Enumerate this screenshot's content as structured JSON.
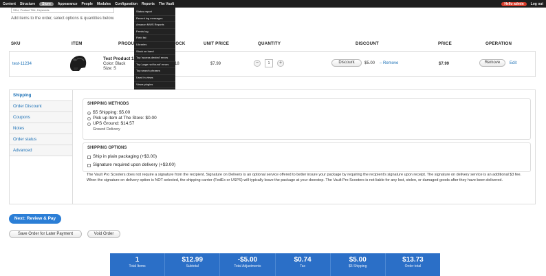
{
  "admin_bar": {
    "menu": [
      "Content",
      "Structure",
      "Store",
      "Appearance",
      "People",
      "Modules",
      "Configuration",
      "Reports",
      "The Vault"
    ],
    "user": "Hello admin",
    "logout": "Log out"
  },
  "reports_menu": [
    "Status report",
    "Recent log messages",
    "Amazon MWS Reports",
    "Feeds log",
    "Field list",
    "Libraries",
    "Stock on hand",
    "Top 'access denied' errors",
    "Top 'page not found' errors",
    "Top search phrases",
    "Used in views",
    "Views plugins"
  ],
  "order": {
    "search_placeholder": "SKU, Product Title, Keywords",
    "add_items_text": "Add items to the order, select options & quantities below.",
    "columns": [
      "SKU",
      "ITEM",
      "PRODUCT",
      "STOCK",
      "UNIT PRICE",
      "QUANTITY",
      "DISCOUNT",
      "PRICE",
      "OPERATION"
    ],
    "line": {
      "sku": "test-11234",
      "product_name": "Test Product 1",
      "color": "Color: Black",
      "size": "Size: S",
      "stock": "18",
      "unit_price": "$7.99",
      "qty_minus": "−",
      "quantity": "1",
      "qty_plus": "+",
      "discount_button": "Discount",
      "discount_amount": "$5.00",
      "discount_remove": "– Remove",
      "price": "$7.99",
      "remove_button": "Remove",
      "edit_link": "Edit"
    }
  },
  "tabs": [
    "Shipping",
    "Order Discount",
    "Coupons",
    "Notes",
    "Order status",
    "Advanced"
  ],
  "shipping": {
    "methods_legend": "SHIPPING METHODS",
    "methods": [
      {
        "label": "$5 Shipping: $5.00",
        "selected": true
      },
      {
        "label": "Pick up item at The Store: $0.00",
        "selected": false
      },
      {
        "label": "UPS Ground: $14.57",
        "selected": false
      }
    ],
    "ups_sub": "Ground Delivery",
    "options_legend": "SHIPPING OPTIONS",
    "options": [
      "Ship in plain packaging (+$3.00)",
      "Signature required upon delivery (+$3.00)"
    ],
    "note": "The Vault Pro Scooters does not require a signature from the recipient. Signature on Delivery is an optional service offered to better insure your package by requiring the recipient's signature upon receipt. The signature on delivery service is an additional $3 fee. When the signature on delivery option is NOT selected, the shipping carrier (FedEx or USPS) will typically leave the package at your doorstep. The Vault Pro Scooters is not liable for any lost, stolen, or damaged goods after they have been delivered."
  },
  "actions": {
    "next": "Next: Review & Pay",
    "save": "Save Order for Later Payment",
    "void": "Void Order"
  },
  "summary": [
    {
      "value": "1",
      "label": "Total Items"
    },
    {
      "value": "$12.99",
      "label": "Subtotal"
    },
    {
      "value": "-$5.00",
      "label": "Total Adjustments"
    },
    {
      "value": "$0.74",
      "label": "Tax"
    },
    {
      "value": "$5.00",
      "label": "$5 Shipping"
    },
    {
      "value": "$13.73",
      "label": "Order total"
    }
  ],
  "colors": {
    "accent": "#2b7ed6",
    "summary_bg": "#2b6fc7",
    "link": "#1a6fb5",
    "user_badge": "#d43b2a"
  }
}
